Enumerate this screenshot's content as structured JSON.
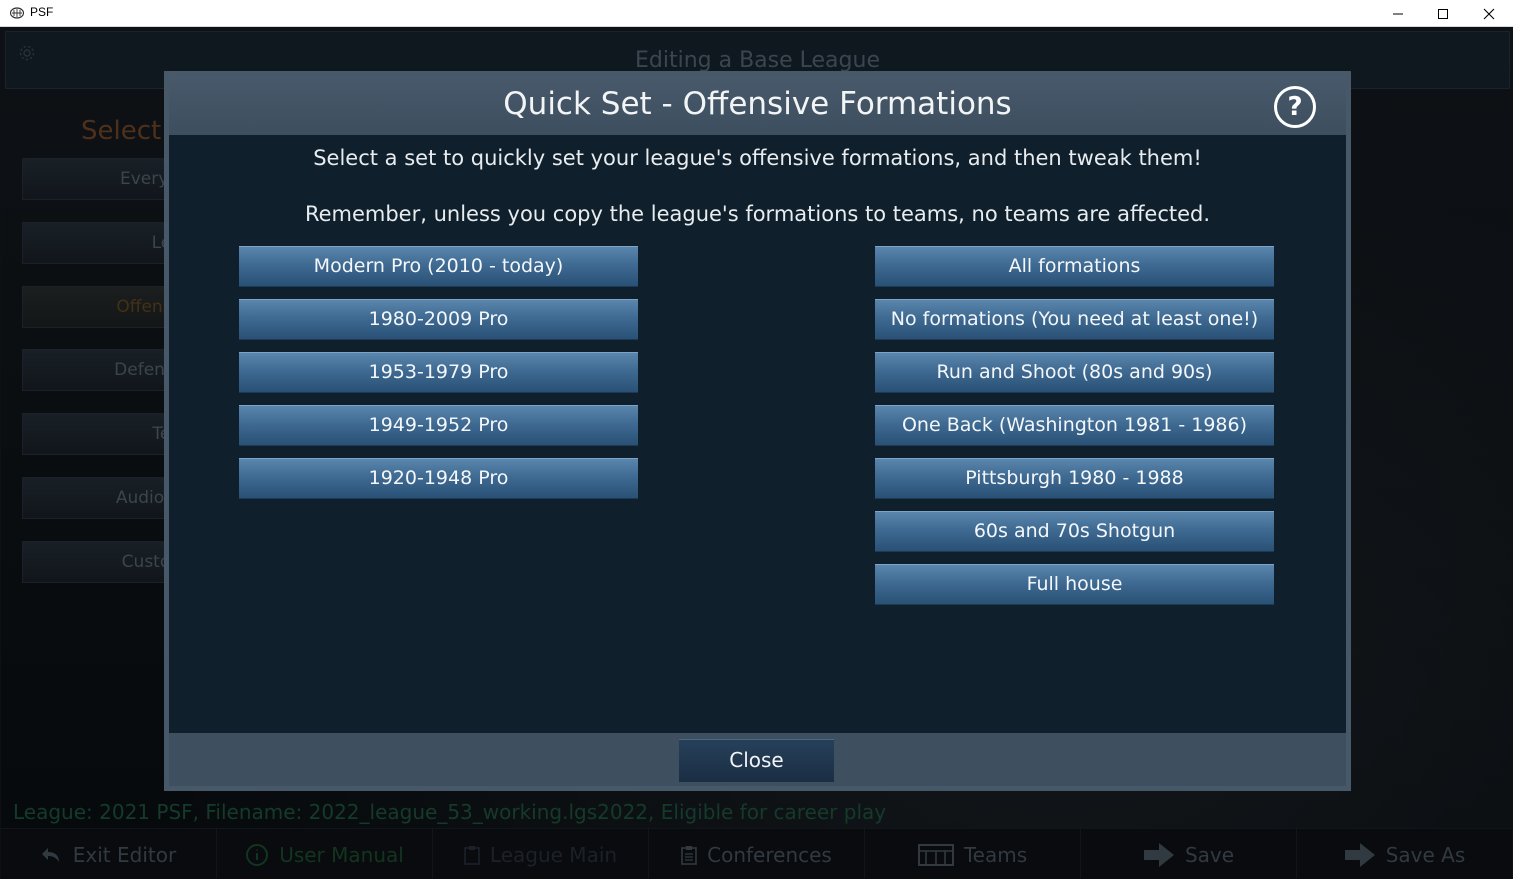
{
  "window": {
    "title": "PSF"
  },
  "app": {
    "header_title": "Editing a Base League",
    "left_title": "Select I",
    "left_buttons": [
      "Everything (",
      "Leag",
      "Offensive Pla",
      "Defensive Pla",
      "Tean",
      "Audio, Image",
      "Custom Nar"
    ],
    "status_line": "League: 2021 PSF,  Filename: 2022_league_53_working.lgs2022,  Eligible for career play",
    "footer": {
      "exit_editor": "Exit Editor",
      "user_manual": "User Manual",
      "league_main": "League Main",
      "conferences": "Conferences",
      "teams": "Teams",
      "save": "Save",
      "save_as": "Save As"
    }
  },
  "modal": {
    "title": "Quick Set - Offensive Formations",
    "help_label": "?",
    "description_1": "Select a set to quickly set your league's offensive formations, and then tweak them!",
    "description_2": "Remember, unless you copy the league's formations to teams, no teams are affected.",
    "left_options": [
      "Modern Pro (2010 - today)",
      "1980-2009 Pro",
      "1953-1979 Pro",
      "1949-1952 Pro",
      "1920-1948 Pro"
    ],
    "right_options": [
      "All formations",
      "No formations (You need at least one!)",
      "Run and Shoot (80s and 90s)",
      "One Back (Washington 1981 - 1986)",
      "Pittsburgh 1980 - 1988",
      "60s and 70s Shotgun",
      "Full house"
    ],
    "close_label": "Close"
  }
}
